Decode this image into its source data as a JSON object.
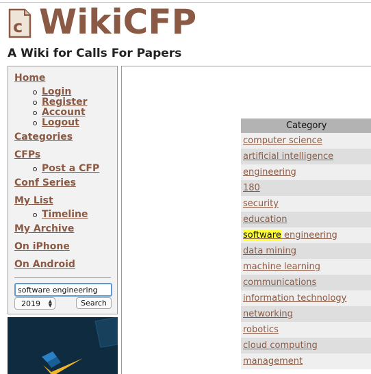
{
  "site": {
    "logo_letter": "c",
    "logo_text": "WikiCFP",
    "tagline": "A Wiki for Calls For Papers"
  },
  "nav": {
    "home": "Home",
    "login": "Login",
    "register": "Register",
    "account": "Account",
    "logout": "Logout",
    "categories": "Categories",
    "cfps": "CFPs",
    "post_cfp": "Post a CFP",
    "conf_series": "Conf Series",
    "my_list": "My List",
    "timeline": "Timeline",
    "my_archive": "My Archive",
    "on_iphone": "On iPhone",
    "on_android": "On Android"
  },
  "search": {
    "query": "software engineering",
    "year": "2019",
    "button_label": "Search"
  },
  "category_table": {
    "header": "Category",
    "rows": [
      {
        "pre": "",
        "hl": "",
        "text": "computer science"
      },
      {
        "pre": "",
        "hl": "",
        "text": "artificial intelligence"
      },
      {
        "pre": "",
        "hl": "",
        "text": "engineering"
      },
      {
        "pre": "",
        "hl": "",
        "text": "180"
      },
      {
        "pre": "",
        "hl": "",
        "text": "security"
      },
      {
        "pre": "",
        "hl": "",
        "text": "education"
      },
      {
        "pre": "",
        "hl": "software",
        "text": " engineering"
      },
      {
        "pre": "",
        "hl": "",
        "text": "data mining"
      },
      {
        "pre": "",
        "hl": "",
        "text": "machine learning"
      },
      {
        "pre": "",
        "hl": "",
        "text": "communications"
      },
      {
        "pre": "",
        "hl": "",
        "text": "information technology"
      },
      {
        "pre": "",
        "hl": "",
        "text": "networking"
      },
      {
        "pre": "",
        "hl": "",
        "text": "robotics"
      },
      {
        "pre": "",
        "hl": "",
        "text": "cloud computing"
      },
      {
        "pre": "",
        "hl": "",
        "text": "management"
      }
    ]
  },
  "colors": {
    "link": "#8a5a44",
    "highlight": "#ffff33",
    "ad_background": "#0f2b3f"
  },
  "icons": [
    "document-logo-icon",
    "select-arrows-icon"
  ]
}
